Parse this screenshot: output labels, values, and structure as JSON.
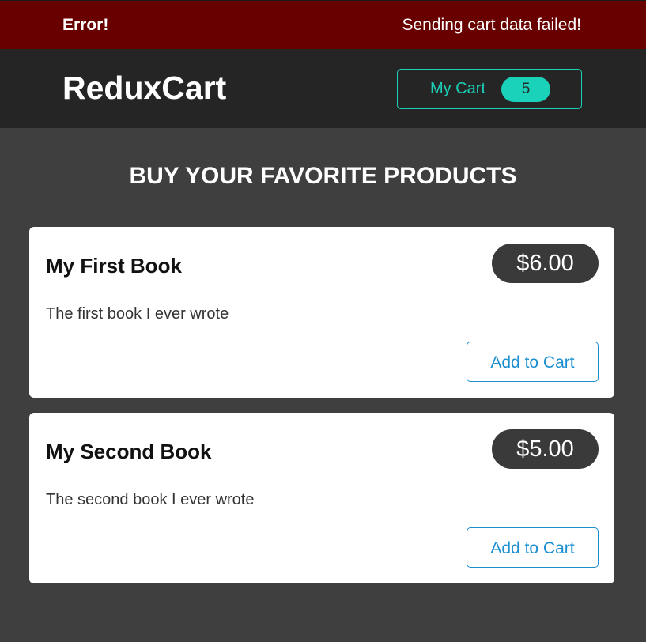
{
  "notification": {
    "title": "Error!",
    "message": "Sending cart data failed!",
    "color": "#690000"
  },
  "header": {
    "brand": "ReduxCart",
    "cart_button": {
      "label": "My Cart",
      "count": "5",
      "accent_color": "#1ad1b9"
    }
  },
  "main": {
    "heading": "BUY YOUR FAVORITE PRODUCTS",
    "products": [
      {
        "name": "My First Book",
        "price": "$6.00",
        "description": "The first book I ever wrote",
        "add_label": "Add to Cart"
      },
      {
        "name": "My Second Book",
        "price": "$5.00",
        "description": "The second book I ever wrote",
        "add_label": "Add to Cart"
      }
    ]
  }
}
